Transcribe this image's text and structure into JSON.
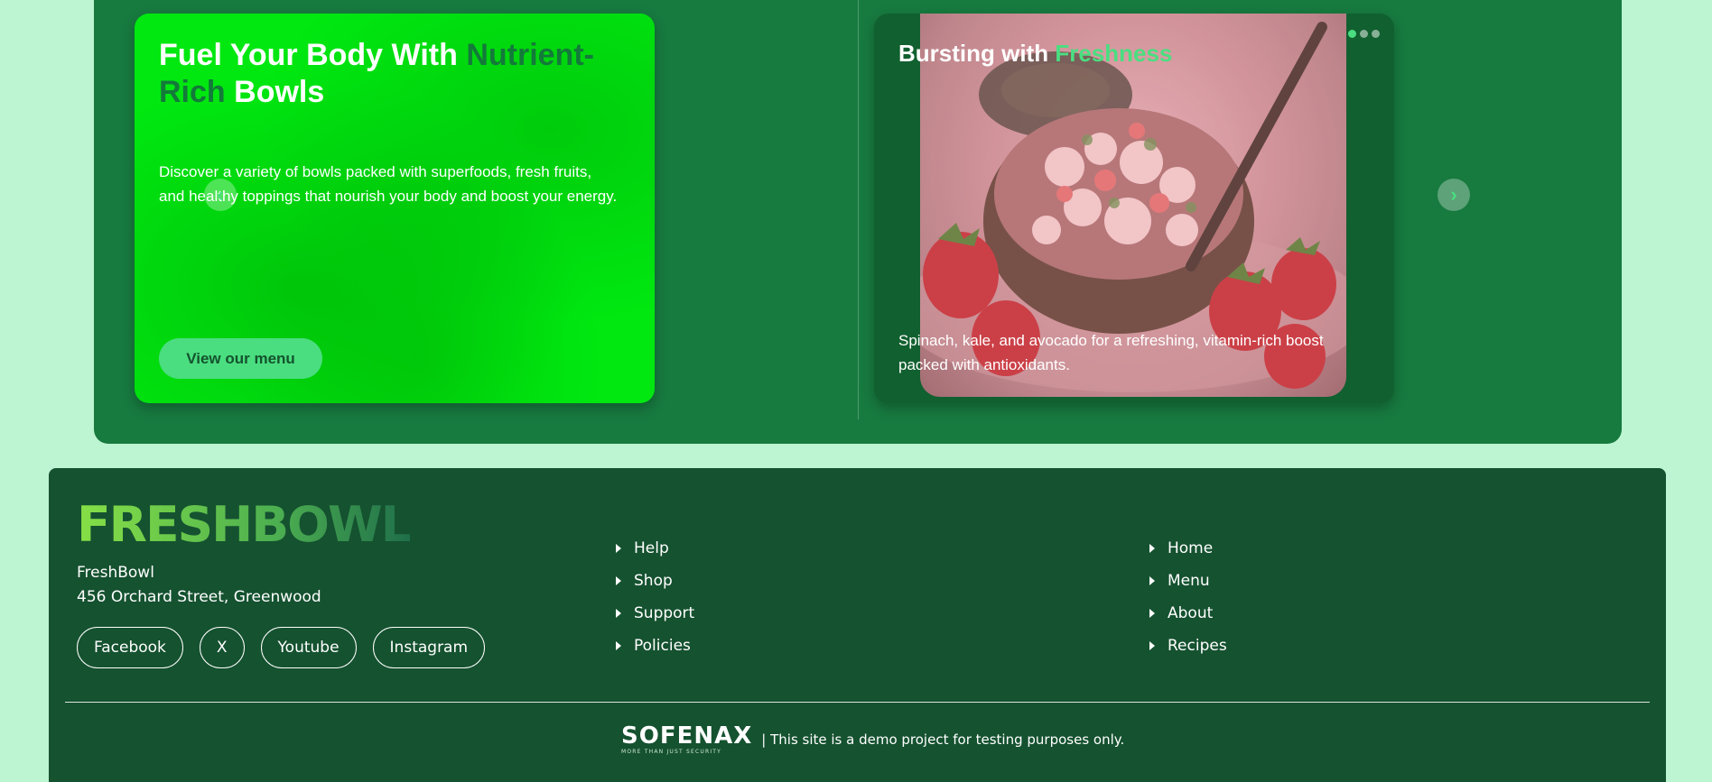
{
  "promo": {
    "left_card": {
      "title_part1": "Fuel Your Body With ",
      "title_accent": "Nutrient-Rich",
      "title_part2": " Bowls",
      "description": "Discover a variety of bowls packed with superfoods, fresh fruits, and healthy toppings that nourish your body and boost your energy.",
      "button_label": "View our menu"
    },
    "right_card": {
      "title_part1": "Bursting with ",
      "title_accent": "Freshness",
      "description": "Spinach, kale, and avocado for a refreshing, vitamin-rich boost packed with antioxidants.",
      "slide_count": 3,
      "active_slide": 1,
      "prev_icon": "chevron-left-icon",
      "next_icon": "chevron-right-icon"
    }
  },
  "footer": {
    "logo_text": "FRESHBOWL",
    "brand_name": "FreshBowl",
    "address": "456 Orchard Street, Greenwood",
    "socials": [
      "Facebook",
      "X",
      "Youtube",
      "Instagram"
    ],
    "links_col1": [
      "Help",
      "Shop",
      "Support",
      "Policies"
    ],
    "links_col2": [
      "Home",
      "Menu",
      "About",
      "Recipes"
    ],
    "partner_logo": "SOFENAX",
    "partner_tagline": "MORE THAN JUST SECURITY",
    "disclaimer": "| This site is a demo project for testing purposes only."
  },
  "colors": {
    "page_bg": "#bdf4d1",
    "promo_bg": "#177a3f",
    "footer_bg": "#155230",
    "accent": "#4ade80",
    "left_card_bg": "#00e810"
  }
}
